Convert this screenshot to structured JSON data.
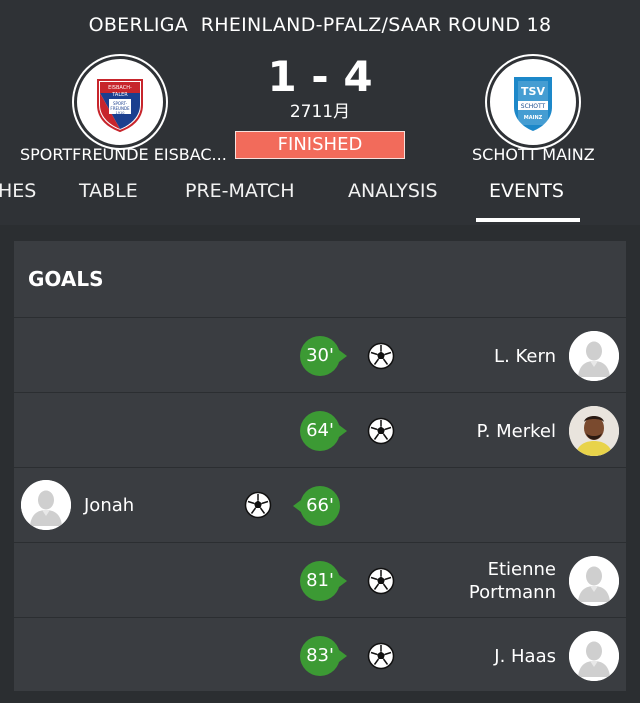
{
  "match": {
    "competition": "OBERLIGA  RHEINLAND-PFALZ/SAAR ROUND 18",
    "score": "1 - 4",
    "date": "2711月",
    "status": "FINISHED",
    "home_team": "SPORTFREUNDE EISBAC...",
    "away_team": "SCHOTT MAINZ",
    "home_crest_text": [
      "EISBACH-",
      "TALER",
      "SPORT-",
      "FREUNDE",
      "1910"
    ],
    "away_crest_text": [
      "TSV",
      "SCHOTT",
      "MAINZ"
    ]
  },
  "tabs": [
    {
      "label": "HES"
    },
    {
      "label": "TABLE"
    },
    {
      "label": "PRE-MATCH"
    },
    {
      "label": "ANALYSIS"
    },
    {
      "label": "EVENTS",
      "active": true
    }
  ],
  "goals": {
    "title": "GOALS",
    "events": [
      {
        "minute": "30'",
        "player": "L. Kern",
        "side": "away",
        "avatar": "placeholder"
      },
      {
        "minute": "64'",
        "player": "P. Merkel",
        "side": "away",
        "avatar": "photo"
      },
      {
        "minute": "66'",
        "player": "Jonah",
        "side": "home",
        "avatar": "placeholder"
      },
      {
        "minute": "81'",
        "player": "Etienne\nPortmann",
        "side": "away",
        "avatar": "placeholder"
      },
      {
        "minute": "83'",
        "player": "J. Haas",
        "side": "away",
        "avatar": "placeholder"
      }
    ]
  },
  "colors": {
    "background": "#2b2e31",
    "panel": "#3a3d41",
    "accent_green": "#3c9a34",
    "status_red": "#f26b5b"
  },
  "icons": {
    "goal": "soccer-ball-icon",
    "avatar": "player-avatar-icon"
  }
}
